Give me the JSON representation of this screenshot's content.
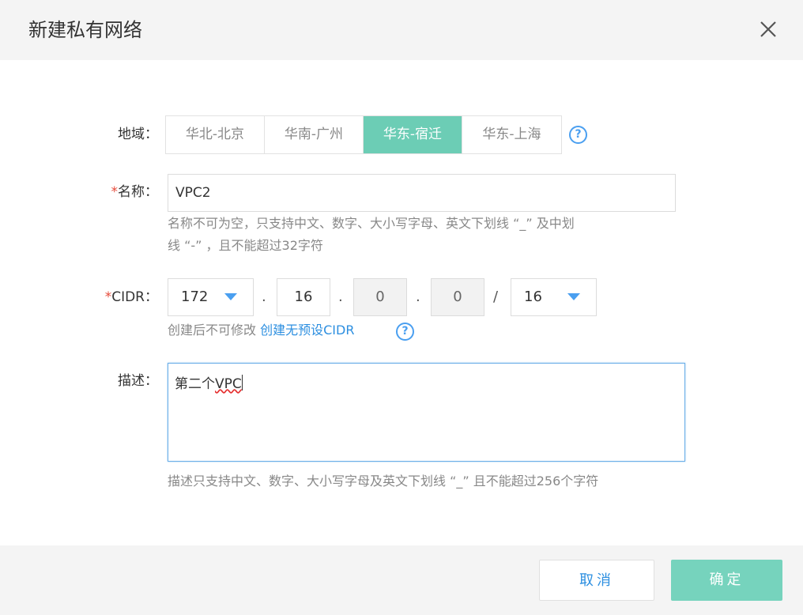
{
  "dialog": {
    "title": "新建私有网络",
    "close_icon": "close-icon"
  },
  "region": {
    "label": "地域：",
    "tabs": [
      {
        "label": "华北-北京",
        "active": false
      },
      {
        "label": "华南-广州",
        "active": false
      },
      {
        "label": "华东-宿迁",
        "active": true
      },
      {
        "label": "华东-上海",
        "active": false
      }
    ],
    "help_icon": "question-icon"
  },
  "name": {
    "required_mark": "*",
    "label": "名称：",
    "value": "VPC2",
    "hint_line1": "名称不可为空，只支持中文、数字、大小写字母、英文下划线 “_” 及中划",
    "hint_line2": "线 “-” ，且不能超过32字符"
  },
  "cidr": {
    "required_mark": "*",
    "label": "CIDR：",
    "octet1": "172",
    "octet2": "16",
    "octet3": "0",
    "octet4": "0",
    "dot": ".",
    "slash": "/",
    "mask": "16",
    "hint": "创建后不可修改",
    "link": "创建无预设CIDR",
    "help_icon": "question-icon"
  },
  "description": {
    "label": "描述：",
    "value_prefix": "第二个",
    "value_spell": "VPC",
    "hint": "描述只支持中文、数字、大小写字母及英文下划线 “_” 且不能超过256个字符"
  },
  "buttons": {
    "cancel": "取消",
    "ok": "确定"
  },
  "colors": {
    "accent_green": "#6ccdb5",
    "link_blue": "#2d8fe0",
    "required_red": "#e64b3b"
  }
}
